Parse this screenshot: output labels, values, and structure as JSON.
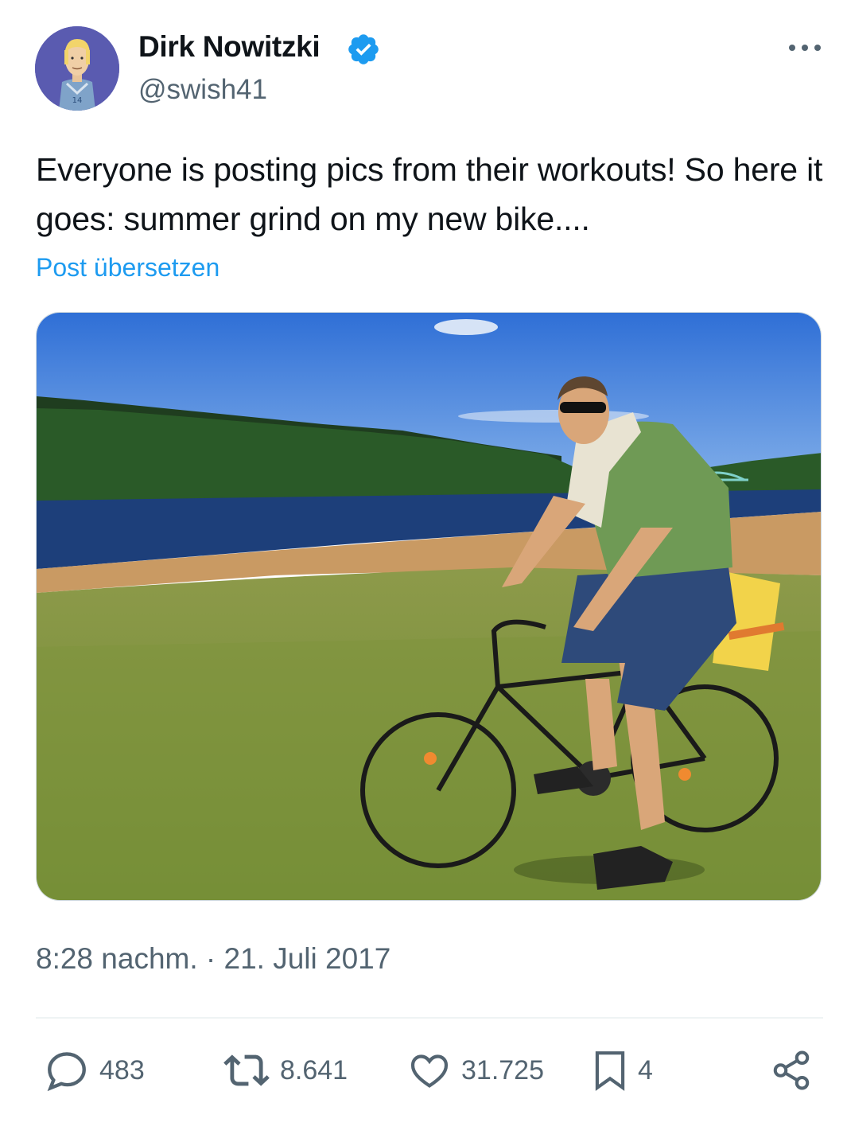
{
  "author": {
    "display_name": "Dirk Nowitzki",
    "handle": "@swish41",
    "verified_icon": "verified-badge-icon",
    "avatar_icon": "cartoon-avatar"
  },
  "menu": {
    "icon": "more-horizontal-icon"
  },
  "post": {
    "text": "Everyone is posting pics from their workouts! So here it goes: summer grind on my new bike....",
    "translate_label": "Post übersetzen",
    "timestamp": "8:28 nachm. · 21. Juli 2017"
  },
  "stats": {
    "replies": "483",
    "reposts": "8.641",
    "likes": "31.725",
    "bookmarks": "4"
  },
  "colors": {
    "accent": "#1d9bf0",
    "secondary_text": "#536471",
    "primary_text": "#0f1419",
    "divider": "#eff3f4"
  }
}
